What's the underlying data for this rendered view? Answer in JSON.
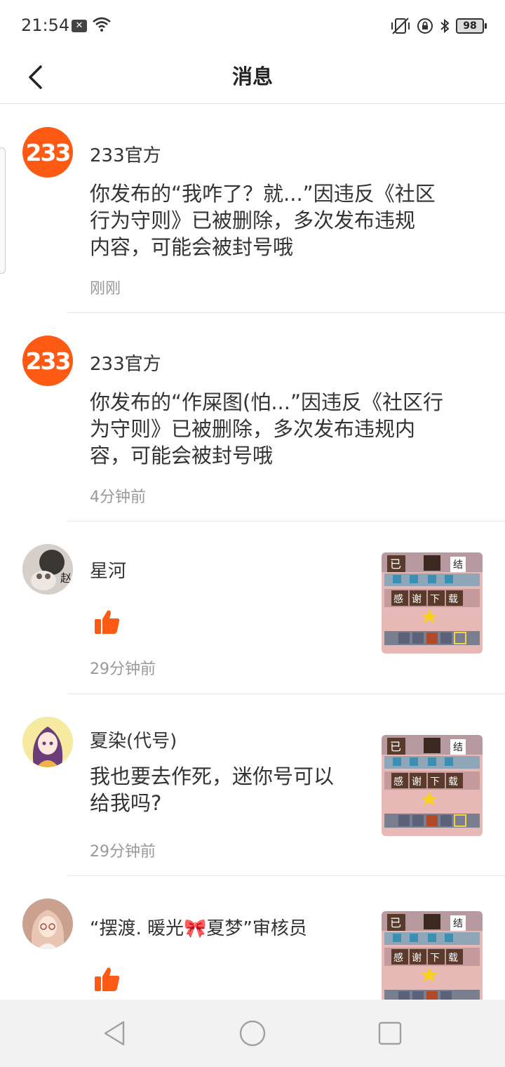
{
  "status_bar": {
    "time": "21:54",
    "battery": "98"
  },
  "header": {
    "title": "消息"
  },
  "messages": [
    {
      "sender": "233官方",
      "avatar_text": "233",
      "content": [
        "你发布的“我咋了？就...”因违反《社区",
        "行为守则》已被删除，多次发布违规",
        "内容，可能会被封号哦"
      ],
      "time": "刚刚",
      "type": "notice"
    },
    {
      "sender": "233官方",
      "avatar_text": "233",
      "content": [
        "你发布的“作屎图(怕...”因违反《社区行",
        "为守则》已被删除，多次发布违规内",
        "容，可能会被封号哦"
      ],
      "time": "4分钟前",
      "type": "notice"
    },
    {
      "sender": "星河",
      "time": "29分钟前",
      "type": "like",
      "thumb_text": [
        "已",
        "结",
        "感",
        "谢",
        "下",
        "载"
      ]
    },
    {
      "sender": "夏染(代号)",
      "content": [
        "我也要去作死，迷你号可以",
        "给我吗?"
      ],
      "time": "29分钟前",
      "type": "comment",
      "thumb_text": [
        "已",
        "结",
        "感",
        "谢",
        "下",
        "载"
      ]
    },
    {
      "sender": "“摆渡. 暖光🎀夏梦”审核员",
      "type": "like",
      "thumb_text": [
        "已",
        "结",
        "感",
        "谢",
        "下",
        "载"
      ]
    }
  ],
  "colors": {
    "accent": "#ff5a14",
    "like": "#ff5a14"
  }
}
